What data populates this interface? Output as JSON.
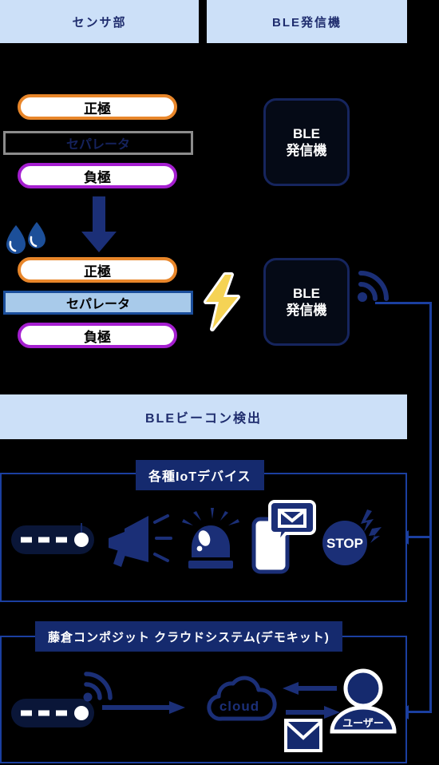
{
  "colors": {
    "background": "#000000",
    "banner_bg": "#CCE0F8",
    "banner_text": "#1F2D6E",
    "navy": "#152A6E",
    "navy_line": "#1B3FA0",
    "positive_electrode": "#E8862A",
    "negative_electrode": "#A51FD0",
    "separator_wet_fill": "#A8CAEA",
    "separator_wet_border": "#1B4E9B",
    "separator_dry_border": "#8C8C8C",
    "bolt_yellow": "#F5D355",
    "water_blue": "#1B4E9B",
    "white": "#FFFFFF"
  },
  "banners": {
    "sensor": "センサ部",
    "ble": "BLE発信機",
    "beacon": "BLEビーコン検出"
  },
  "sensor_stack_dry": {
    "positive": "正極",
    "separator": "セパレータ",
    "negative": "負極",
    "state": "dry"
  },
  "sensor_stack_wet": {
    "positive": "正極",
    "separator": "セパレータ",
    "negative": "負極",
    "state": "wet"
  },
  "ble_box": {
    "line1": "BLE",
    "line2": "発信機"
  },
  "icons": {
    "down_arrow": "down-arrow-icon",
    "water_drops": "water-drop-icon",
    "lightning_bolt": "lightning-bolt-icon",
    "wifi": "wifi-signal-icon",
    "sensor_tag": "sensor-tag-icon",
    "megaphone": "megaphone-icon",
    "siren": "siren-light-icon",
    "phone_mail": "phone-mail-notification-icon",
    "stop_sign": "stop-sign-icon",
    "cloud": "cloud-icon",
    "user": "user-avatar-icon",
    "mail": "mail-envelope-icon",
    "arrow_right": "arrow-right-icon",
    "arrow_left": "arrow-left-icon"
  },
  "panels": {
    "iot": {
      "title": "各種IoTデバイス",
      "devices": [
        {
          "name": "sensor-tag",
          "label": ""
        },
        {
          "name": "megaphone",
          "label": ""
        },
        {
          "name": "siren",
          "label": ""
        },
        {
          "name": "phone-mail",
          "label": ""
        },
        {
          "name": "stop-sign",
          "label": "STOP"
        }
      ]
    },
    "cloud": {
      "title": "藤倉コンポジット クラウドシステム(デモキット)",
      "cloud_label": "cloud",
      "user_label": "ユーザー"
    }
  }
}
